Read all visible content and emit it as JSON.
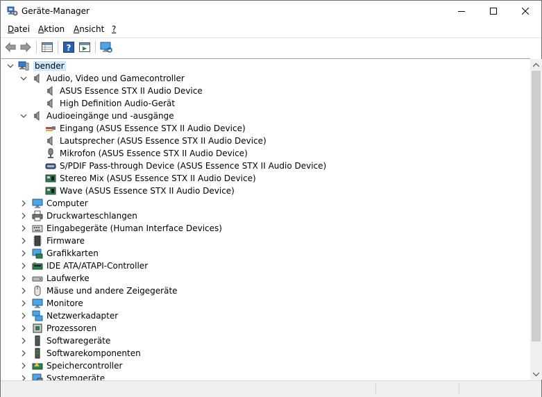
{
  "window": {
    "title": "Geräte-Manager"
  },
  "menu": [
    {
      "label": "Datei",
      "underline": "D",
      "rest": "atei"
    },
    {
      "label": "Aktion",
      "underline": "A",
      "rest": "ktion"
    },
    {
      "label": "Ansicht",
      "underline": "A",
      "rest": "nsicht"
    },
    {
      "label": "?",
      "underline": "?",
      "rest": ""
    }
  ],
  "toolbar": [
    "back-icon",
    "forward-icon",
    "properties-grid-icon",
    "help-icon",
    "run-icon",
    "monitor-icon"
  ],
  "tree": {
    "root": {
      "label": "bender",
      "icon": "computer-icon",
      "expanded": true
    },
    "rows": [
      {
        "label": "Audio, Video und Gamecontroller",
        "icon": "speaker-icon",
        "expanded": true
      },
      {
        "label": "ASUS Essence STX II Audio Device",
        "icon": "speaker-icon"
      },
      {
        "label": "High Definition Audio-Gerät",
        "icon": "speaker-icon"
      },
      {
        "label": "Audioeingänge und -ausgänge",
        "icon": "speaker-icon",
        "expanded": true
      },
      {
        "label": "Eingang (ASUS Essence STX II Audio Device)",
        "icon": "cable-icon"
      },
      {
        "label": "Lautsprecher (ASUS Essence STX II Audio Device)",
        "icon": "speaker-icon"
      },
      {
        "label": "Mikrofon (ASUS Essence STX II Audio Device)",
        "icon": "microphone-icon"
      },
      {
        "label": "S/PDIF Pass-through Device (ASUS Essence STX II Audio Device)",
        "icon": "spdif-icon"
      },
      {
        "label": "Stereo Mix (ASUS Essence STX II Audio Device)",
        "icon": "audio-card-icon"
      },
      {
        "label": "Wave (ASUS Essence STX II Audio Device)",
        "icon": "audio-card-icon"
      },
      {
        "label": "Computer",
        "icon": "monitor-icon",
        "expanded": false
      },
      {
        "label": "Druckwarteschlangen",
        "icon": "printer-icon",
        "expanded": false
      },
      {
        "label": "Eingabegeräte (Human Interface Devices)",
        "icon": "keyboard-icon",
        "expanded": false
      },
      {
        "label": "Firmware",
        "icon": "chip-icon",
        "expanded": false
      },
      {
        "label": "Grafikkarten",
        "icon": "display-adapter-icon",
        "expanded": false
      },
      {
        "label": "IDE ATA/ATAPI-Controller",
        "icon": "controller-icon",
        "expanded": false
      },
      {
        "label": "Laufwerke",
        "icon": "drive-icon",
        "expanded": false
      },
      {
        "label": "Mäuse und andere Zeigegeräte",
        "icon": "mouse-icon",
        "expanded": false
      },
      {
        "label": "Monitore",
        "icon": "monitor-icon",
        "expanded": false
      },
      {
        "label": "Netzwerkadapter",
        "icon": "network-icon",
        "expanded": false
      },
      {
        "label": "Prozessoren",
        "icon": "processor-icon",
        "expanded": false
      },
      {
        "label": "Softwaregeräte",
        "icon": "software-device-icon",
        "expanded": false
      },
      {
        "label": "Softwarekomponenten",
        "icon": "software-component-icon",
        "expanded": false
      },
      {
        "label": "Speichercontroller",
        "icon": "storage-controller-icon",
        "expanded": false
      },
      {
        "label": "Systemgeräte",
        "icon": "system-device-icon",
        "expanded": false
      }
    ]
  },
  "colors": {
    "selection": "#cce8ff",
    "expander": "#404040"
  }
}
